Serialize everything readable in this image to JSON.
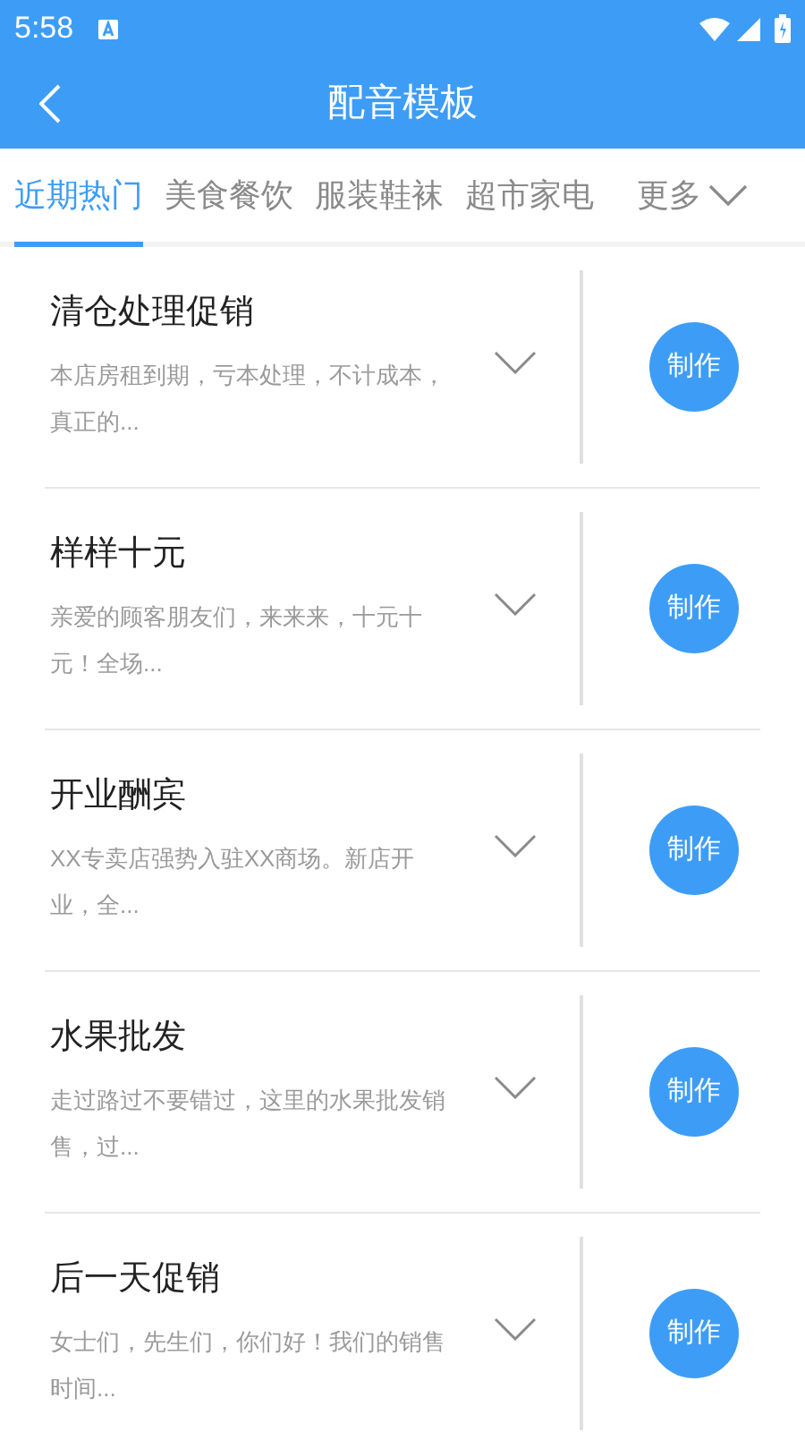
{
  "status_bar": {
    "time": "5:58"
  },
  "header": {
    "title": "配音模板"
  },
  "tabs": [
    {
      "label": "近期热门",
      "selected": true
    },
    {
      "label": "美食餐饮",
      "selected": false
    },
    {
      "label": "服装鞋袜",
      "selected": false
    },
    {
      "label": "超市家电",
      "selected": false
    }
  ],
  "more_tab": {
    "label": "更多"
  },
  "templates": [
    {
      "title": "清仓处理促销",
      "description": "本店房租到期，亏本处理，不计成本，真正的...",
      "button": "制作"
    },
    {
      "title": "样样十元",
      "description": "亲爱的顾客朋友们，来来来，十元十元！全场...",
      "button": "制作"
    },
    {
      "title": "开业酬宾",
      "description": "XX专卖店强势入驻XX商场。新店开业，全...",
      "button": "制作"
    },
    {
      "title": "水果批发",
      "description": "走过路过不要错过，这里的水果批发销售，过...",
      "button": "制作"
    },
    {
      "title": "后一天促销",
      "description": "女士们，先生们，你们好！我们的销售时间...",
      "button": "制作"
    }
  ]
}
